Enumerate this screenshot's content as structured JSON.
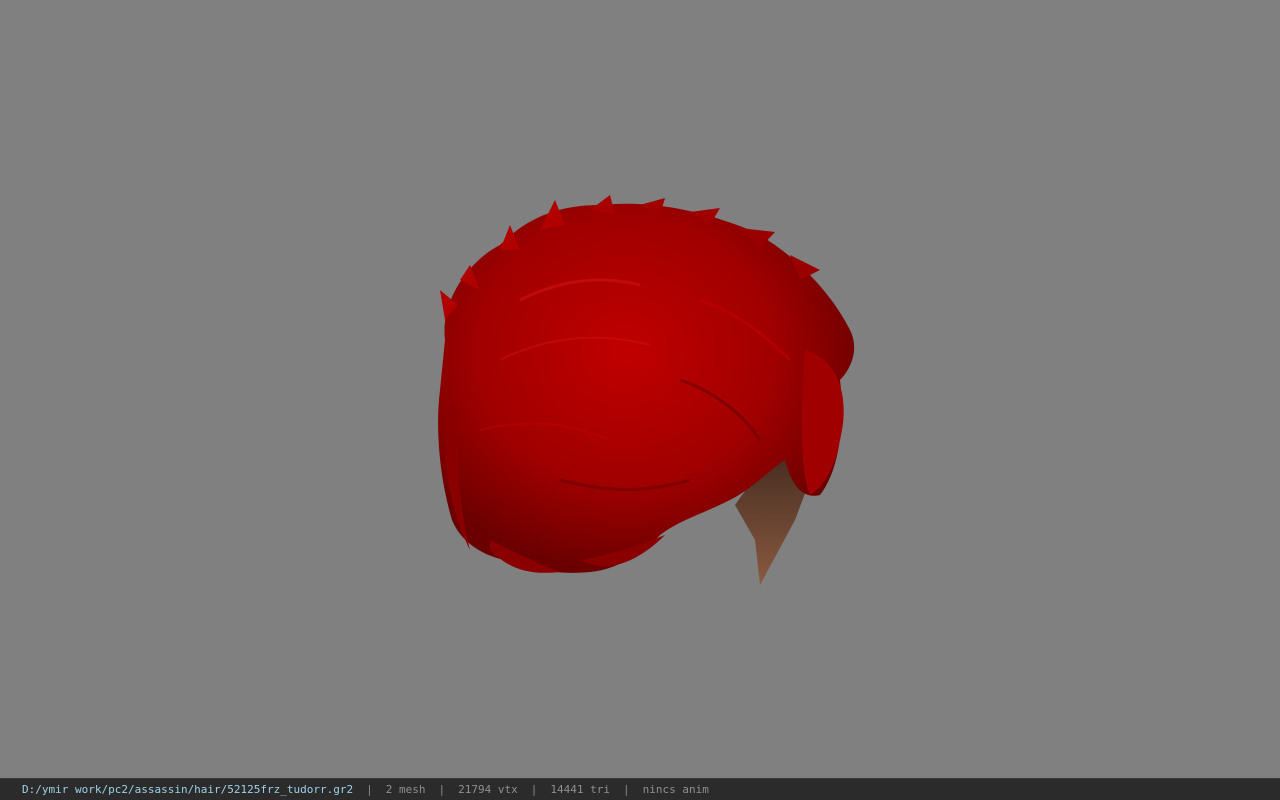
{
  "app": {
    "background_color": "#808080",
    "hair_color": "#b00000",
    "skin_color": "#6b4430"
  },
  "viewport": {
    "model_name": "hair-mesh"
  },
  "statusbar": {
    "file_path": "D:/ymir work/pc2/assassin/hair/52125frz_tudorr.gr2",
    "separator": "|",
    "mesh_count": "2 mesh",
    "vertex_count": "21794 vtx",
    "triangle_count": "14441 tri",
    "anim_status": "nincs anim"
  }
}
